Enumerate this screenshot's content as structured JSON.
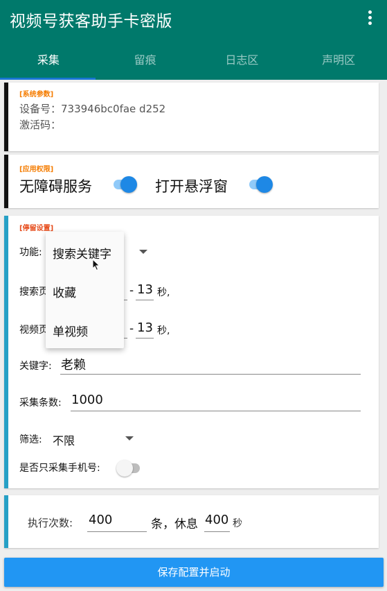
{
  "app": {
    "title": "视频号获客助手卡密版",
    "menu_icon": "more-vert-icon"
  },
  "tabs": [
    {
      "label": "采集",
      "active": true
    },
    {
      "label": "留痕",
      "active": false
    },
    {
      "label": "日志区",
      "active": false
    },
    {
      "label": "声明区",
      "active": false
    }
  ],
  "system": {
    "section_label": "[系统参数]",
    "device_line": "设备号：733946bc0fae d252",
    "activation_line": "激活码："
  },
  "permissions": {
    "section_label": "[应用权限]",
    "accessibility_label": "无障碍服务",
    "accessibility_on": true,
    "overlay_label": "打开悬浮窗",
    "overlay_on": true
  },
  "stay": {
    "section_label": "[停留设置]",
    "function_label": "功能:",
    "search_row_label": "搜索页",
    "search_range_sep": "-",
    "search_max": "13",
    "search_unit": "秒,",
    "video_row_label": "视频页",
    "video_range_sep": "-",
    "video_max": "13",
    "video_unit": "秒,",
    "keyword_label": "关键字:",
    "keyword_value": "老赖",
    "count_label": "采集条数:",
    "count_value": "1000",
    "filter_label": "筛选:",
    "filter_value": "不限",
    "phone_only_label": "是否只采集手机号:",
    "phone_only_on": false
  },
  "function_dropdown": {
    "options": [
      "搜索关键字",
      "收藏",
      "单视频"
    ]
  },
  "execution": {
    "times_label": "执行次数:",
    "times_value": "400",
    "rest_label": "条，休息",
    "rest_value": "400",
    "rest_unit": "秒"
  },
  "actions": {
    "start_label": "保存配置并启动"
  },
  "colors": {
    "appbar": "#00796b",
    "accent": "#1976d2",
    "system_label": "#f57c00",
    "permission_label": "#f57c00",
    "stay_label": "#e64a19",
    "switch_on": "#1e88e5"
  }
}
